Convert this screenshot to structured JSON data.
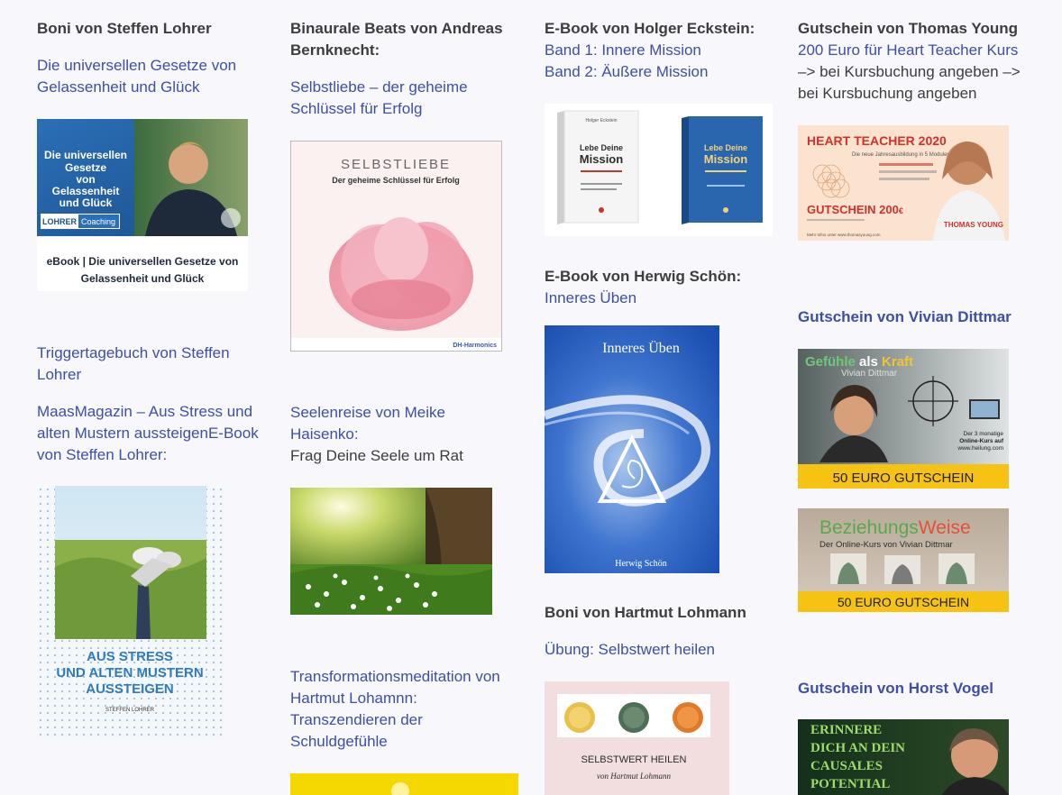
{
  "col1": {
    "heading": "Boni von Steffen Lohrer",
    "link1": [
      "Die universellen Gesetze von",
      "Gelassenheit und Glück"
    ],
    "image1": {
      "title": [
        "Die universellen",
        "Gesetze",
        "von",
        "Gelassenheit",
        "und Glück"
      ],
      "badge1": "LOHRER",
      "badge2": "Coaching",
      "caption": [
        "eBook | Die universellen Gesetze von",
        "Gelassenheit und Glück"
      ]
    },
    "link2": [
      "Triggertagebuch von Steffen",
      "Lohrer"
    ],
    "link3": [
      "MaasMagazin – Aus Stress und",
      "alten Mustern aussteigenE-Book",
      "von Steffen Lohrer:"
    ],
    "image2": {
      "title": [
        "AUS STRESS",
        "UND ALTEN MUSTERN",
        "AUSSTEIGEN"
      ],
      "author": "STEFFEN LOHRER"
    }
  },
  "col2": {
    "heading": [
      "Binaurale Beats von Andreas",
      "Bernknecht:"
    ],
    "link1": [
      "Selbstliebe – der geheime",
      "Schlüssel für Erfolg"
    ],
    "image1": {
      "title": "SELBSTLIEBE",
      "subtitle": "Der geheime Schlüssel für Erfolg",
      "logo": "DH-Harmonics"
    },
    "link2": [
      "Seelenreise von Meike",
      "Haisenko:"
    ],
    "text2": "Frag Deine Seele um Rat",
    "link3": [
      "Transformationsmeditation von",
      "Hartmut Lohamnn:",
      "Transzendieren der",
      "Schuldgefühle"
    ]
  },
  "col3": {
    "heading": "E-Book von Holger Eckstein:",
    "link1": [
      "Band 1: Innere Mission",
      "Band 2: Äußere Mission"
    ],
    "image1": {
      "author": "Holger Eckstein",
      "title1": [
        "Lebe Deine",
        "Mission"
      ],
      "title2": [
        "Lebe Deine",
        "Mission"
      ]
    },
    "heading2": "E-Book von Herwig Schön:",
    "link2": "Inneres Üben",
    "image2": {
      "title": "Inneres Üben",
      "author": "Herwig Schön"
    },
    "heading3": "Boni von Hartmut Lohmann",
    "link3": "Übung: Selbstwert heilen",
    "image3": {
      "title": "SELBSTWERT HEILEN",
      "author": "von Hartmut Lohmann"
    }
  },
  "col4": {
    "heading": "Gutschein von Thomas Young",
    "link1": "200 Euro für Heart Teacher Kurs",
    "text1": [
      "–> bei Kursbuchung angeben –>",
      "bei Kursbuchung angeben"
    ],
    "image1": {
      "title": "HEART TEACHER 2020",
      "subtitle": "Die neue Jahresausbildung in 5 Modulen",
      "voucher": "GUTSCHEIN 200",
      "currency": "€",
      "name": "THOMAS YOUNG",
      "web": "Mehr Infos unter www.thomasyoung.com"
    },
    "heading2": "Gutschein von Vivian Dittmar",
    "image2": {
      "title_a": "Gefühle",
      "title_b": " als ",
      "title_c": "Kraft",
      "author": "Vivian Dittmar",
      "note": [
        "Der 3 monatige",
        "Online-Kurs auf",
        "www.heilung.com"
      ],
      "voucher": "50 EURO GUTSCHEIN"
    },
    "image3": {
      "title_a": "Beziehungs",
      "title_b": "Weise",
      "subtitle": "Der Online-Kurs von Vivian Dittmar",
      "voucher": "50 EURO GUTSCHEIN"
    },
    "heading3": "Gutschein von Horst Vogel",
    "image4": {
      "lines": [
        "ERINNERE",
        "DICH AN DEIN",
        "CAUSALES",
        "POTENTIAL"
      ]
    }
  },
  "colors": {
    "link": "#3f4fa3",
    "text": "#3d3d3d",
    "bg": "#f7f7fc",
    "accent_yellow": "#f6c312"
  }
}
